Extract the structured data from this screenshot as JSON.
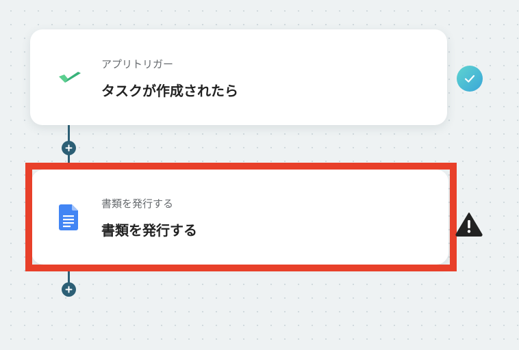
{
  "flow": {
    "steps": [
      {
        "caption": "アプリトリガー",
        "title": "タスクが作成されたら",
        "icon": "app-trigger-check-icon",
        "status": "completed",
        "status_icon": "check-circle-icon"
      },
      {
        "caption": "書類を発行する",
        "title": "書類を発行する",
        "icon": "google-docs-icon",
        "status": "warning",
        "status_icon": "warning-triangle-icon"
      }
    ],
    "add_step_icon": "plus-icon"
  },
  "colors": {
    "connector": "#2c5f75",
    "highlight": "#e8402a",
    "trigger_icon": "#4cc58a",
    "docs_icon": "#4285f4",
    "status_ok": "#3aa6d8",
    "status_warn": "#222222"
  }
}
